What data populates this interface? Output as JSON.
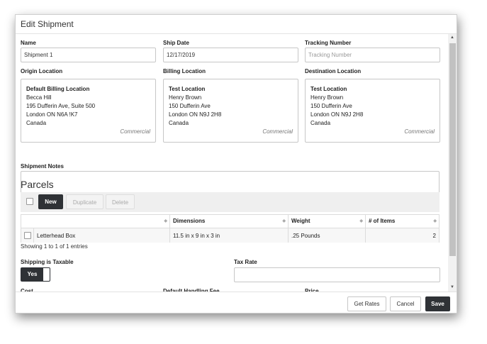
{
  "modal": {
    "title": "Edit Shipment"
  },
  "fields": {
    "name": {
      "label": "Name",
      "value": "Shipment 1"
    },
    "ship_date": {
      "label": "Ship Date",
      "value": "12/17/2019"
    },
    "tracking": {
      "label": "Tracking Number",
      "placeholder": "Tracking Number"
    }
  },
  "locations": {
    "origin": {
      "label": "Origin Location",
      "name": "Default Billing Location",
      "contact": "Becca Hill",
      "street": "195 Dufferin Ave, Suite 500",
      "city": "London ON N6A !K7",
      "country": "Canada",
      "type": "Commercial"
    },
    "billing": {
      "label": "Billing Location",
      "name": "Test Location",
      "contact": "Henry Brown",
      "street": "150 Dufferin Ave",
      "city": "London ON N9J 2H8",
      "country": "Canada",
      "type": "Commercial"
    },
    "destination": {
      "label": "Destination Location",
      "name": "Test Location",
      "contact": "Henry Brown",
      "street": "150 Dufferin Ave",
      "city": "London ON N9J 2H8",
      "country": "Canada",
      "type": "Commercial"
    }
  },
  "notes": {
    "label": "Shipment Notes",
    "value": ""
  },
  "parcels": {
    "heading": "Parcels",
    "buttons": {
      "new": "New",
      "duplicate": "Duplicate",
      "delete": "Delete"
    },
    "columns": {
      "dimensions": "Dimensions",
      "weight": "Weight",
      "items": "# of Items"
    },
    "rows": [
      {
        "name": "Letterhead Box",
        "dimensions": "11.5 in x 9 in x 3 in",
        "weight": ".25 Pounds",
        "items": "2"
      }
    ],
    "info": "Showing 1 to 1 of 1 entries"
  },
  "taxable": {
    "label": "Shipping is Taxable",
    "toggle": "Yes"
  },
  "tax_rate": {
    "label": "Tax Rate",
    "value": ""
  },
  "cut_labels": {
    "cost": "Cost",
    "handling": "Default Handling Fee",
    "price": "Price"
  },
  "footer": {
    "get_rates": "Get Rates",
    "cancel": "Cancel",
    "save": "Save"
  }
}
